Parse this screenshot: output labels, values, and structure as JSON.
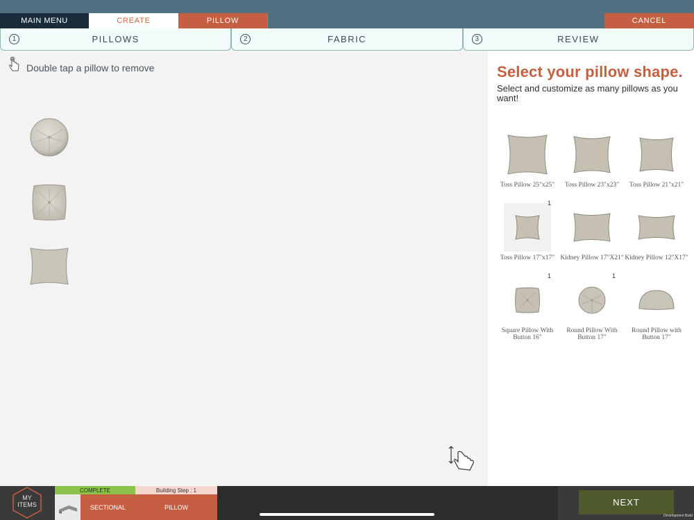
{
  "nav": {
    "main_menu": "MAIN MENU",
    "create": "CREATE",
    "pillow": "PILLOW",
    "cancel": "CANCEL"
  },
  "steps": [
    {
      "number": "1",
      "label": "PILLOWS"
    },
    {
      "number": "2",
      "label": "FABRIC"
    },
    {
      "number": "3",
      "label": "REVIEW"
    }
  ],
  "canvas": {
    "hint": "Double tap a pillow to remove",
    "hint_icon": "tap-hand-icon",
    "placed_pillows": [
      "round-pillow",
      "square-tufted-pillow",
      "toss-pillow"
    ]
  },
  "panel": {
    "title": "Select your pillow shape.",
    "subtitle": "Select and customize as many pillows as you want!",
    "shapes": [
      {
        "label": "Toss Pillow 25\"x25\"",
        "count": ""
      },
      {
        "label": "Toss Pillow 23\"x23\"",
        "count": ""
      },
      {
        "label": "Toss Pillow 21\"x21\"",
        "count": ""
      },
      {
        "label": "Toss Pillow 17\"x17\"",
        "count": "1"
      },
      {
        "label": "Kidney Pillow 17\"X21\"",
        "count": ""
      },
      {
        "label": "Kidney Pillow 12\"X17\"",
        "count": ""
      },
      {
        "label": "Square Pillow With Button 16\"",
        "count": "1"
      },
      {
        "label": "Round Pillow With Button 17\"",
        "count": "1"
      },
      {
        "label": "Round Pillow with Button 17\"",
        "count": ""
      }
    ]
  },
  "bottom": {
    "my_items": "MY ITEMS",
    "complete": "COMPLETE",
    "building_step": "Building Step : 1",
    "sectional": "SECTIONAL",
    "pillow": "PILLOW",
    "next": "NEXT",
    "dev_build": "Development Build"
  },
  "colors": {
    "header": "#517080",
    "accent": "#c65f41",
    "dark_tab": "#182c3a",
    "next_button": "#4e5a2c",
    "complete_green": "#8bc34a"
  }
}
